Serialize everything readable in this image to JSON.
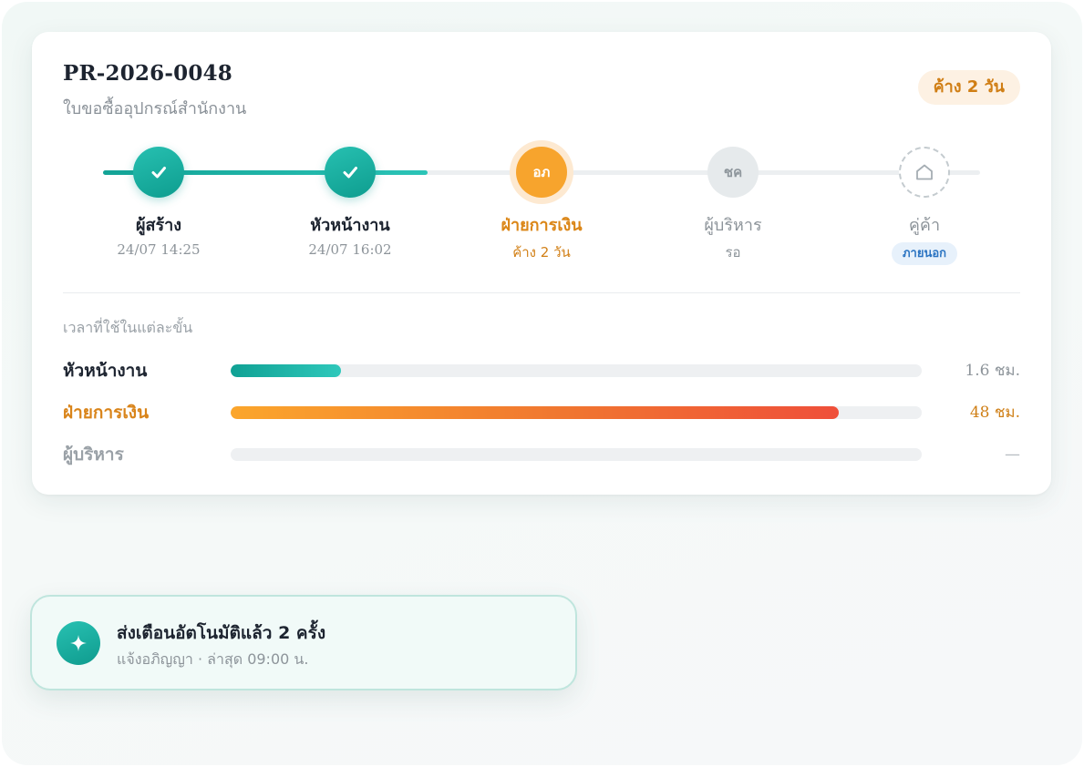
{
  "request": {
    "id": "PR-2026-0048",
    "description": "ใบขอซื้ออุปกรณ์สำนักงาน",
    "pending_badge": "ค้าง 2 วัน"
  },
  "steps": [
    {
      "initials": "",
      "title": "ผู้สร้าง",
      "subtitle": "24/07 14:25",
      "state": "done",
      "icon": "check-icon"
    },
    {
      "initials": "",
      "title": "หัวหน้างาน",
      "subtitle": "24/07 16:02",
      "state": "done",
      "icon": "check-icon"
    },
    {
      "initials": "อภ",
      "title": "ฝ่ายการเงิน",
      "subtitle": "ค้าง 2 วัน",
      "state": "active"
    },
    {
      "initials": "ชค",
      "title": "ผู้บริหาร",
      "subtitle": "รอ",
      "state": "waiting"
    },
    {
      "initials": "",
      "title": "คู่ค้า",
      "subtitle": "",
      "badge": "ภายนอก",
      "state": "external",
      "icon": "house-icon"
    }
  ],
  "progress_fraction": 0.37,
  "durations": {
    "label": "เวลาที่ใช้ในแต่ละขั้น",
    "rows": [
      {
        "name": "หัวหน้างาน",
        "value": "1.6 ชม.",
        "fraction": 0.16
      },
      {
        "name": "ฝ่ายการเงิน",
        "value": "48 ชม.",
        "fraction": 0.88
      },
      {
        "name": "ผู้บริหาร",
        "value": "—",
        "fraction": 0
      }
    ]
  },
  "notification": {
    "icon": "sparkle-icon",
    "title": "ส่งเตือนอัตโนมัติแล้ว 2 ครั้ง",
    "subtitle": "แจ้งอภิญญา · ล่าสุด 09:00 น."
  },
  "colors": {
    "done": "#13a396",
    "active": "#f7a42d",
    "danger": "#ef4f3a",
    "external": "#2b74c2"
  }
}
